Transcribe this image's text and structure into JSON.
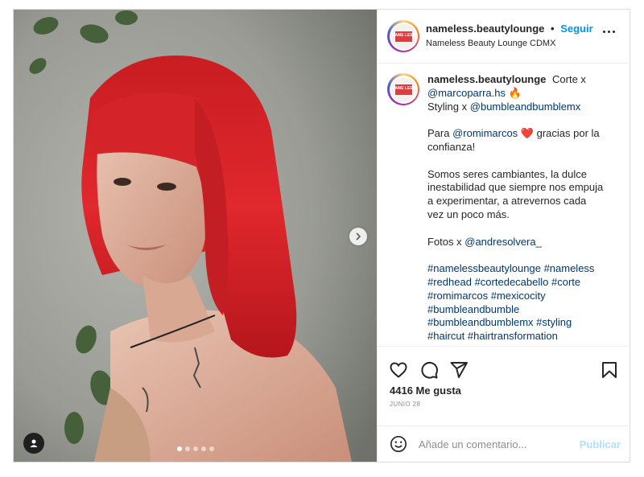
{
  "post": {
    "username": "nameless.beautylounge",
    "separator": "•",
    "follow_label": "Seguir",
    "location": "Nameless Beauty Lounge CDMX",
    "avatar_text": "NAME LESS"
  },
  "caption": {
    "username": "nameless.beautylounge",
    "line1_text": "Corte x",
    "mention_cut": "@marcoparra.hs",
    "fire_emoji": "🔥",
    "styling_text": "Styling x",
    "mention_styling": "@bumbleandbumblemx",
    "para_text": "Para",
    "mention_client": "@romimarcos",
    "heart_emoji": "❤️",
    "thanks_text": "gracias por la confianza!",
    "body": "Somos seres cambiantes, la dulce inestabilidad que siempre nos empuja a experimentar, a atrevernos cada vez un poco más.",
    "photos_text": "Fotos x",
    "mention_photo": "@andresolvera_",
    "hashtags": [
      "#namelessbeautylounge",
      "#nameless",
      "#redhead",
      "#cortedecabello",
      "#corte",
      "#romimarcos",
      "#mexicocity",
      "#bumbleandbumble",
      "#bumbleandbumblemx",
      "#styling",
      "#haircut",
      "#hairtransformation"
    ]
  },
  "stats": {
    "likes": "4416 Me gusta",
    "date": "JUNIO 28"
  },
  "comment": {
    "placeholder": "Añade un comentario...",
    "publish_label": "Publicar"
  },
  "carousel": {
    "current": 1,
    "total": 5
  },
  "colors": {
    "follow_blue": "#0095f6",
    "link_blue": "#00376b",
    "publish_disabled": "#b2dffc",
    "hair_red": "#d8262c"
  },
  "icons": [
    "heart-icon",
    "comment-icon",
    "share-icon",
    "bookmark-icon",
    "emoji-icon",
    "user-tag-icon",
    "chevron-right-icon",
    "more-icon"
  ]
}
